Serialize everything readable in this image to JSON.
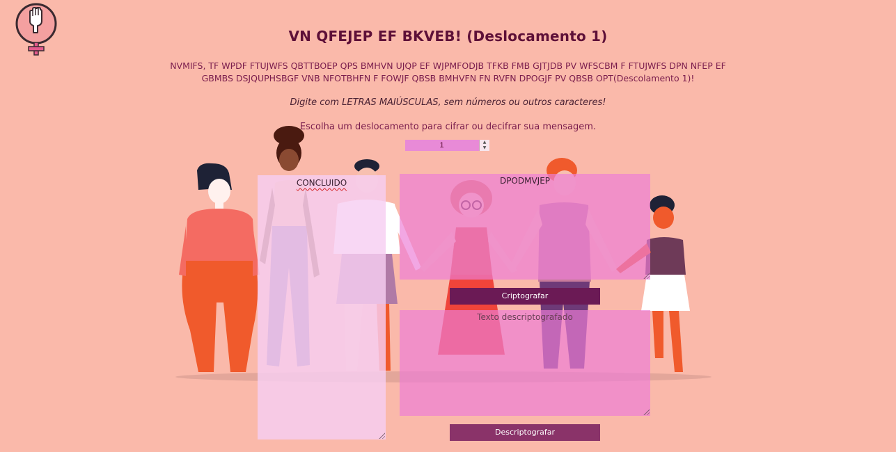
{
  "header": {
    "title": "VN QFEJEP EF BKVEB! (Deslocamento 1)",
    "subtitle": "NVMIFS, TF WPDF FTUJWFS QBTTBOEP QPS BMHVN UJQP EF WJPMFODJB TFKB FMB GJTJDB PV WFSCBM F FTUJWFS DPN NFEP EF GBMBS DSJQUPHSBGF VNB NFOTBHFN F FOWJF QBSB BMHVFN FN RVFN DPOGJF PV QBSB OPT(Descolamento 1)!",
    "instruction": "Digite com LETRAS MAIÚSCULAS, sem números ou outros caracteres!"
  },
  "shift": {
    "label": "Escolha um deslocamento para cifrar ou decifrar sua mensagem.",
    "value": "1"
  },
  "plaintext_box": {
    "value": "CONCLUIDO"
  },
  "cipher_input_box": {
    "value": "DPODMVJEP"
  },
  "cipher_output_box": {
    "placeholder": "Texto descriptografado"
  },
  "buttons": {
    "encrypt": "Criptografar",
    "decrypt": "Descriptografar"
  },
  "colors": {
    "background": "#fab9aa",
    "title": "#5e1038",
    "accent": "#6b1a55",
    "textbox_pink": "#ec7ed6"
  },
  "icons": {
    "logo": "feminist-fist-icon"
  }
}
